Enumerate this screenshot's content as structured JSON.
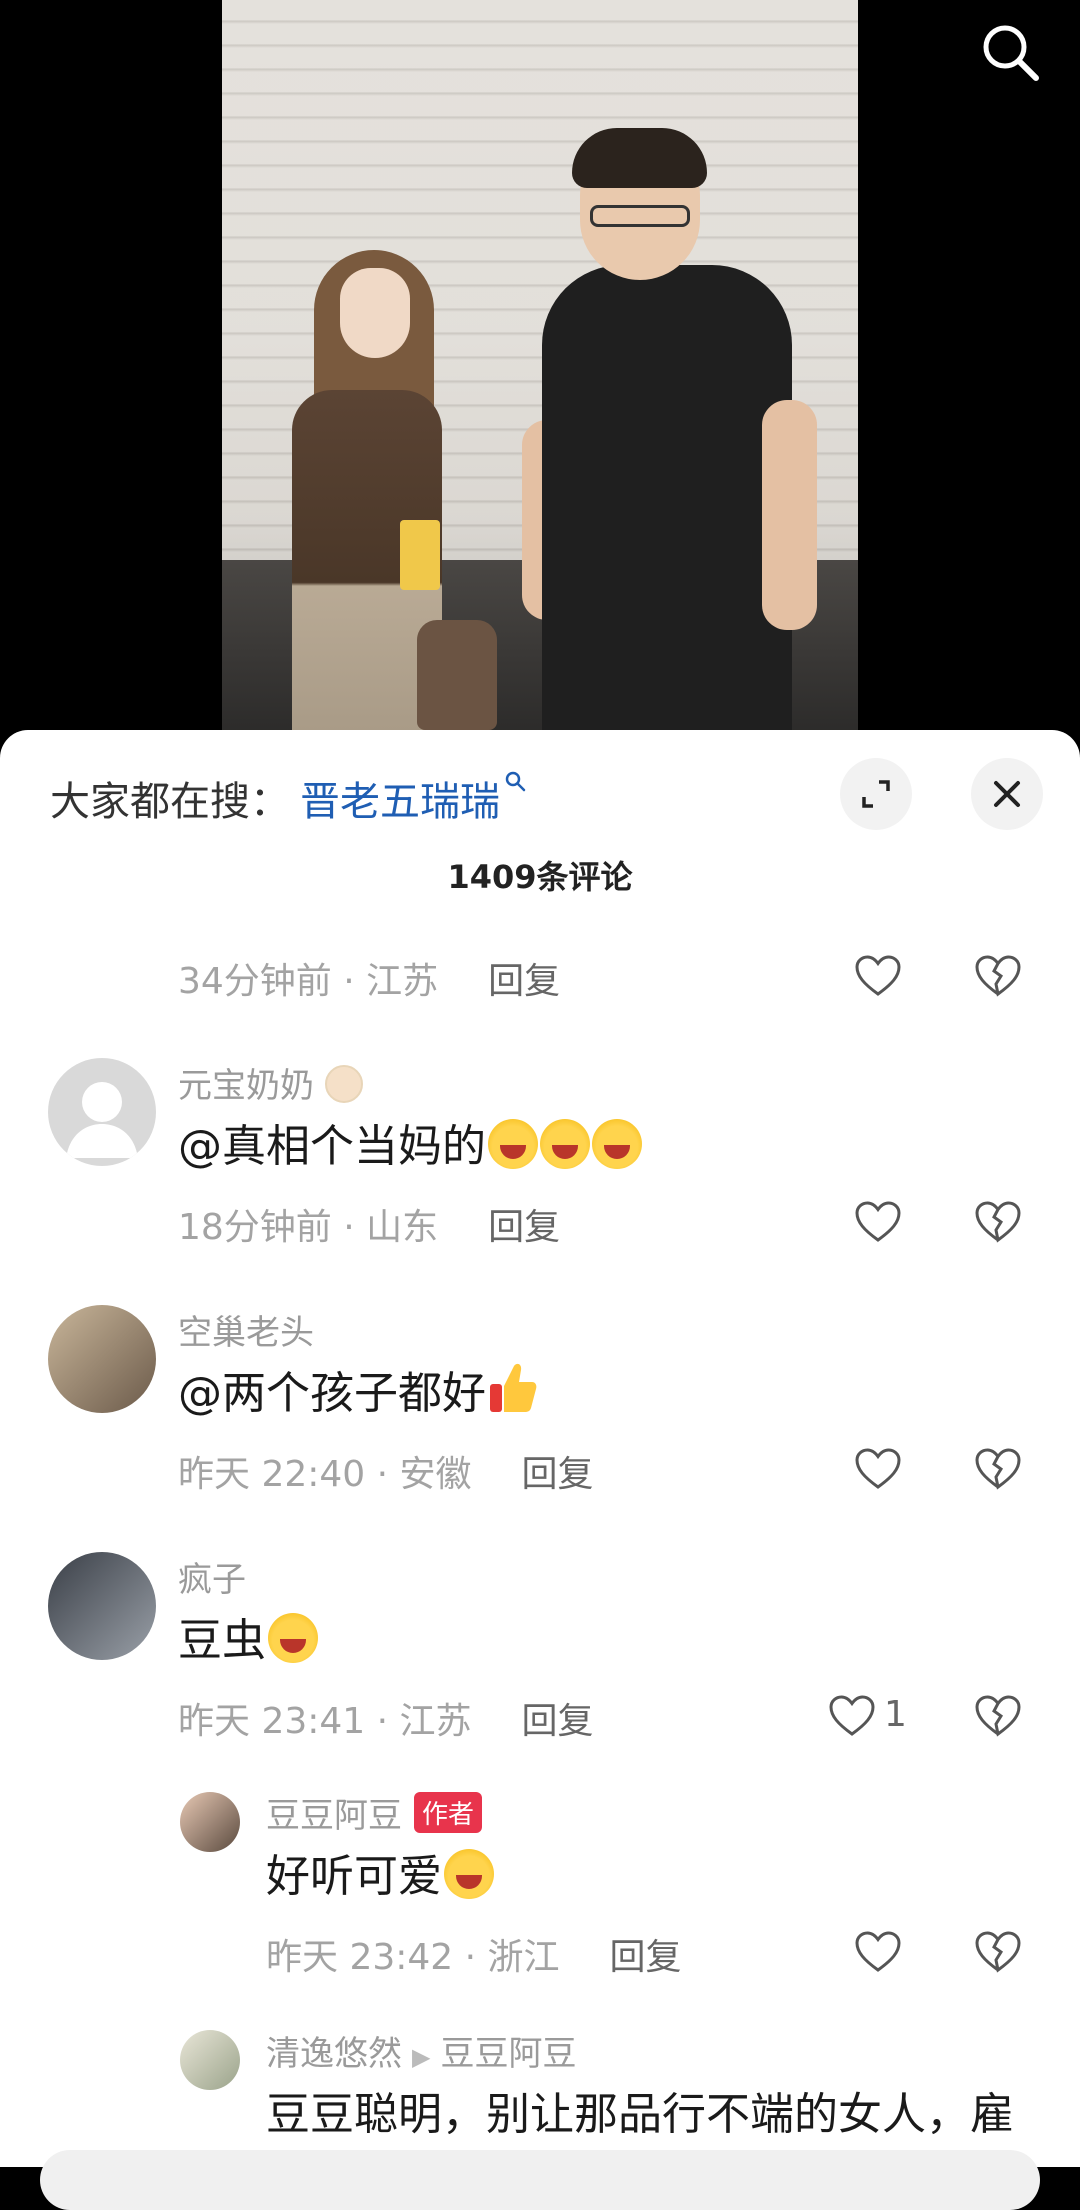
{
  "hot_search": {
    "label": "大家都在搜：",
    "term": "晋老五瑞瑞"
  },
  "comment_count": "1409条评论",
  "first_meta": {
    "time": "34分钟前 · 江苏",
    "reply": "回复"
  },
  "comments": [
    {
      "user": "元宝奶奶",
      "text": "@真相个当妈的",
      "time": "18分钟前 · 山东",
      "reply": "回复"
    },
    {
      "user": "空巢老头",
      "text": "@两个孩子都好",
      "time": "昨天 22:40 · 安徽",
      "reply": "回复"
    },
    {
      "user": "疯子",
      "text": "豆虫",
      "time": "昨天 23:41 · 江苏",
      "reply": "回复",
      "likes": "1"
    }
  ],
  "replies": [
    {
      "user": "豆豆阿豆",
      "badge": "作者",
      "text": "好听可爱",
      "time": "昨天 23:42 · 浙江",
      "reply": "回复"
    },
    {
      "user": "清逸悠然",
      "reply_to": "豆豆阿豆",
      "text": "豆豆聪明，别让那品行不端的女人，雇"
    }
  ],
  "colors": {
    "hot_term": "#1f5eb3",
    "author_badge": "#e8344c",
    "meta": "#a3a3a3"
  }
}
